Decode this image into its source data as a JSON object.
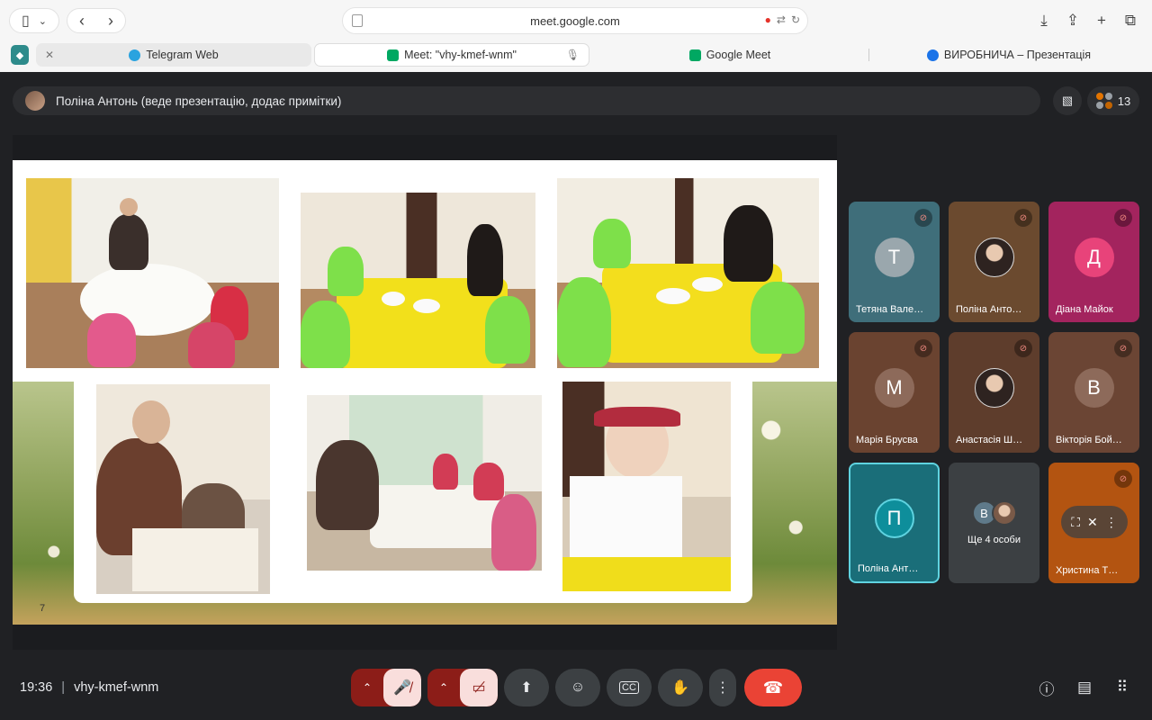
{
  "browser": {
    "url": "meet.google.com",
    "tabs": [
      {
        "title": "Telegram Web",
        "favicon_color": "#2aa3df"
      },
      {
        "title": "Meet: \"vhy-kmef-wnm\"",
        "favicon_color": "#00a862"
      },
      {
        "title": "Google Meet",
        "favicon_color": "#00a862"
      },
      {
        "title": "ВИРОБНИЧА – Презентація",
        "favicon_color": "#1a73e8"
      }
    ]
  },
  "meet": {
    "presenter_banner": "Поліна Антонь (веде презентацію, додає примітки)",
    "participant_count": "13",
    "slide_number": "7",
    "participants": [
      {
        "name": "Тетяна Вале…",
        "initial": "Т",
        "bg": "#3f6e7a",
        "avatar": "#9aa7ad",
        "muted": true
      },
      {
        "name": "Поліна Анто…",
        "initial": "",
        "bg": "#6b4a2f",
        "photo": true,
        "muted": true
      },
      {
        "name": "Діана Майок",
        "initial": "Д",
        "bg": "#a3245e",
        "avatar": "#e8437a",
        "muted": true
      },
      {
        "name": "Марія Брусва",
        "initial": "М",
        "bg": "#6a4330",
        "avatar": "#8d6a5a",
        "muted": true
      },
      {
        "name": "Анастасія Ш…",
        "initial": "",
        "bg": "#5e3d2c",
        "photo": true,
        "muted": true
      },
      {
        "name": "Вікторія Бой…",
        "initial": "В",
        "bg": "#6b4534",
        "avatar": "#8d6a5a",
        "muted": true
      },
      {
        "name": "Поліна Ант…",
        "initial": "П",
        "bg": "#1a6e79",
        "avatar": "#0e8e9b",
        "muted": false
      },
      {
        "name": "Ще 4 особи",
        "initial": "",
        "bg": "#3c4043",
        "more": true,
        "muted": false
      },
      {
        "name": "Христина Т…",
        "initial": "",
        "bg": "#b35411",
        "muted": true
      }
    ],
    "more_avatar_letter": "В",
    "meeting_time": "19:36",
    "meeting_code": "vhy-kmef-wnm"
  },
  "colors": {
    "end_call": "#ea4335",
    "mic_off_bg": "#f9dedc",
    "active_speaker_border": "#5fd3e0"
  }
}
